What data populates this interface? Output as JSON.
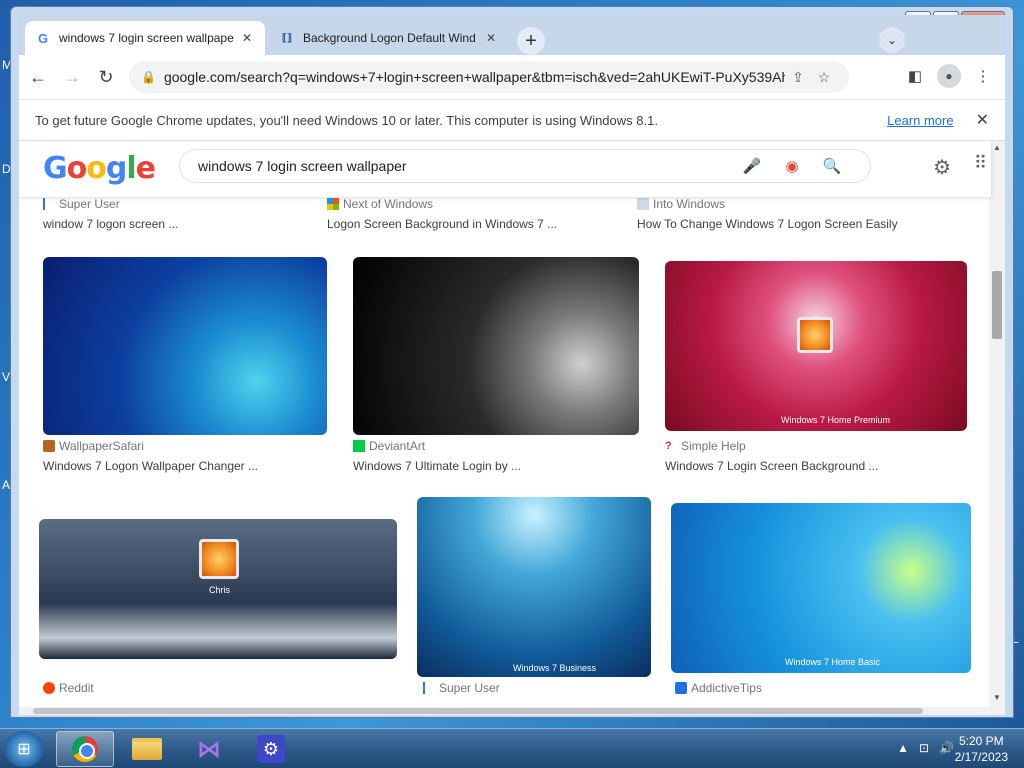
{
  "desktop": {
    "edge_letters": [
      "M",
      "D",
      "V",
      "A",
      "L"
    ]
  },
  "window": {
    "minimize": "▁",
    "maximize": "▢",
    "close": "✕"
  },
  "tabs": [
    {
      "title": "windows 7 login screen wallpape",
      "favicon": "G",
      "close": "✕"
    },
    {
      "title": "Background Logon Default Wind",
      "favicon": "⟦⟧",
      "close": "✕"
    }
  ],
  "newtab_label": "+",
  "tab_search_label": "⌄",
  "toolbar": {
    "back": "←",
    "forward": "→",
    "reload": "↻",
    "url": "google.com/search?q=windows+7+login+screen+wallpaper&tbm=isch&ved=2ahUKEwiT-PuXy539AhXVCl...",
    "share_icon": "⇪",
    "star_icon": "☆",
    "sidepanel_icon": "◧",
    "profile_icon": "●",
    "menu_icon": "⋮"
  },
  "infobar": {
    "message": "To get future Google Chrome updates, you'll need Windows 10 or later. This computer is using Windows 8.1.",
    "learn_more": "Learn more",
    "close": "✕"
  },
  "google": {
    "logo_letters": [
      "G",
      "o",
      "o",
      "g",
      "l",
      "e"
    ],
    "query": "windows 7 login screen wallpaper",
    "mic_icon": "🎤",
    "lens_icon": "◉",
    "search_icon": "🔍",
    "settings_icon": "⚙",
    "apps_icon": "⠿"
  },
  "results": {
    "row0": [
      {
        "source": "Super User",
        "title": "window 7 logon screen ..."
      },
      {
        "source": "Next of Windows",
        "title": "Logon Screen Background in Windows 7 ..."
      },
      {
        "source": "Into Windows",
        "title": "How To Change Windows 7 Logon Screen Easily"
      }
    ],
    "row1": [
      {
        "source": "WallpaperSafari",
        "title": "Windows 7 Logon Wallpaper Changer ..."
      },
      {
        "source": "DeviantArt",
        "title": "Windows 7 Ultimate Login by ..."
      },
      {
        "source": "Simple Help",
        "title": "Windows 7 Login Screen Background ..."
      }
    ],
    "row2": [
      {
        "source": "Reddit"
      },
      {
        "source": "Super User"
      },
      {
        "source": "AddictiveTips"
      }
    ],
    "thumb_labels": {
      "t3_badge": "Windows 7 Home Premium",
      "t4_name": "Chris",
      "t5_badge": "Windows 7 Business",
      "t6_badge": "Windows 7 Home Basic"
    }
  },
  "taskbar": {
    "start_icon": "⊞",
    "tray_arrow": "▲",
    "tray_network": "⊡",
    "tray_volume": "🔊",
    "time": "5:20 PM",
    "date": "2/17/2023"
  }
}
